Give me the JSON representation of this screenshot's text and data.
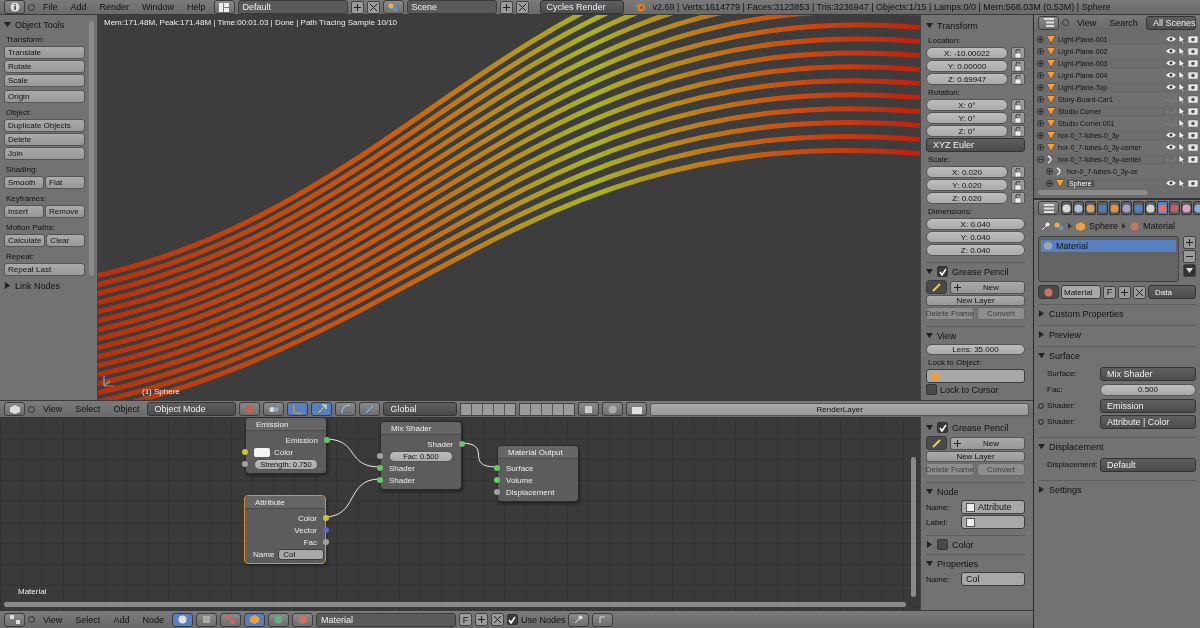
{
  "top_bar": {
    "menus": [
      "File",
      "Add",
      "Render",
      "Window",
      "Help"
    ],
    "layout": "Default",
    "scene": "Scene",
    "engine": "Cycles Render",
    "stats": "v2.69 | Verts:1614779 | Faces:3123853 | Tris:3236947 | Objects:1/15 | Lamps:0/0 | Mem:568.03M (0.53M) | Sphere"
  },
  "tool_shelf": {
    "title": "Object Tools",
    "expanded": true,
    "groups": [
      {
        "label": "Transform:",
        "rows": [
          [
            "Translate"
          ],
          [
            "Rotate"
          ],
          [
            "Scale"
          ]
        ]
      },
      {
        "rows": [
          [
            "Origin"
          ]
        ]
      },
      {
        "label": "Object:",
        "rows": [
          [
            "Duplicate Objects"
          ],
          [
            "Delete"
          ],
          [
            "Join"
          ]
        ]
      },
      {
        "label": "Shading:",
        "rows": [
          [
            "Smooth",
            "Flat"
          ]
        ]
      },
      {
        "label": "Keyframes:",
        "rows": [
          [
            "Insert",
            "Remove"
          ]
        ]
      },
      {
        "label": "Motion Paths:",
        "rows": [
          [
            "Calculate",
            "Clear"
          ]
        ]
      },
      {
        "label": "Repeat:",
        "rows": [
          [
            "Repeat Last"
          ]
        ]
      }
    ],
    "closed_panel": {
      "title": "Link Nodes",
      "expanded": false
    }
  },
  "viewport": {
    "info": "Mem:171.48M, Peak:171.48M | Time:00:01.03 | Done | Path Tracing Sample 10/10",
    "object_label": "(1) Sphere"
  },
  "view_sidebar": {
    "panels": [
      {
        "kind": "transform",
        "title": "Transform",
        "expanded": true,
        "groups": [
          {
            "kind": "vector",
            "label": "Location:",
            "fields": [
              "X: -10.00022",
              "Y: 0.00000",
              "Z: 0.69947"
            ],
            "locks": true
          },
          {
            "kind": "vector",
            "label": "Rotation:",
            "fields": [
              "X: 0°",
              "Y: 0°",
              "Z: 0°"
            ],
            "locks": true
          },
          {
            "kind": "dropdown",
            "value": "XYZ Euler"
          },
          {
            "kind": "vector",
            "label": "Scale:",
            "fields": [
              "X: 0.020",
              "Y: 0.020",
              "Z: 0.020"
            ],
            "locks": true
          },
          {
            "kind": "vector",
            "label": "Dimensions:",
            "fields": [
              "X: 0.040",
              "Y: 0.040",
              "Z: 0.040"
            ],
            "locks": false
          }
        ]
      },
      {
        "kind": "grease_pencil",
        "title": "Grease Pencil",
        "expanded": true,
        "checked": true,
        "new_label": "New",
        "buttons": [
          {
            "label": "New Layer",
            "disabled": false
          }
        ],
        "pair": [
          {
            "label": "Delete Frame",
            "disabled": true
          },
          {
            "label": "Convert",
            "disabled": true
          }
        ]
      },
      {
        "kind": "view",
        "title": "View",
        "expanded": true,
        "lens": "Lens: 35.000",
        "lock_label": "Lock to Object:",
        "cursor": {
          "label": "Lock to Cursor",
          "checked": false
        }
      }
    ]
  },
  "viewport_header": {
    "menus": [
      "View",
      "Select",
      "Object"
    ],
    "mode": "Object Mode",
    "orientation": "Global",
    "render_layer": "RenderLayer"
  },
  "node_editor": {
    "nodes": [
      {
        "title": "Emission",
        "selected": false,
        "rows": [
          {
            "kind": "output",
            "label": "Emission",
            "color": "#63c763"
          },
          {
            "kind": "swatch",
            "label": "Color",
            "color": "#c7c729",
            "swatch": {
              "color": "#f4f4f4"
            }
          },
          {
            "kind": "field",
            "label": "Strength: 0.750",
            "color": "#a1a1a1"
          }
        ]
      },
      {
        "title": "Mix Shader",
        "selected": false,
        "rows": [
          {
            "kind": "output",
            "label": "Shader",
            "color": "#63c763"
          },
          {
            "kind": "field",
            "label": "Fac: 0.500",
            "color": "#a1a1a1"
          },
          {
            "kind": "input",
            "label": "Shader",
            "color": "#63c763"
          },
          {
            "kind": "input",
            "label": "Shader",
            "color": "#63c763"
          }
        ]
      },
      {
        "title": "Material Output",
        "selected": false,
        "rows": [
          {
            "kind": "input",
            "label": "Surface",
            "color": "#63c763"
          },
          {
            "kind": "input",
            "label": "Volume",
            "color": "#63c763"
          },
          {
            "kind": "input",
            "label": "Displacement",
            "color": "#a1a1a1"
          }
        ]
      },
      {
        "title": "Attribute",
        "selected": true,
        "rows": [
          {
            "kind": "output",
            "label": "Color",
            "color": "#c7c729"
          },
          {
            "kind": "output",
            "label": "Vector",
            "color": "#6363c7"
          },
          {
            "kind": "output",
            "label": "Fac",
            "color": "#a1a1a1"
          },
          {
            "kind": "name_field",
            "label": "Name",
            "value": "Col"
          }
        ]
      }
    ],
    "tree_label": "Material"
  },
  "node_sidebar": {
    "panels": [
      {
        "kind": "grease_pencil",
        "title": "Grease Pencil",
        "expanded": true,
        "checked": true,
        "new_label": "New",
        "buttons": [
          {
            "label": "New Layer",
            "disabled": false
          }
        ],
        "pair": [
          {
            "label": "Delete Frame",
            "disabled": true
          },
          {
            "label": "Convert",
            "disabled": true
          }
        ]
      },
      {
        "kind": "fields",
        "title": "Node",
        "expanded": true,
        "fields": [
          {
            "label": "Name:",
            "value": "Attribute",
            "icon": true
          },
          {
            "label": "Label:",
            "icon": true
          }
        ]
      },
      {
        "kind": "color",
        "title": "Color",
        "expanded": false,
        "checked": false
      },
      {
        "kind": "fields",
        "title": "Properties",
        "expanded": true,
        "fields": [
          {
            "label": "Name:",
            "value": "Col",
            "icon": false
          }
        ]
      }
    ]
  },
  "node_header": {
    "menus": [
      "View",
      "Select",
      "Add",
      "Node"
    ],
    "material": "Material",
    "fake_user": "F",
    "use_nodes": {
      "label": "Use Nodes",
      "checked": true
    }
  },
  "outliner": {
    "menus": [
      "View",
      "Search"
    ],
    "filter": "All Scenes",
    "items": [
      {
        "name": "Light-Plane-001",
        "kind": "mesh",
        "restrict": true,
        "visible": true,
        "selected": false,
        "expanded": false
      },
      {
        "name": "Light-Plane-002",
        "kind": "mesh",
        "restrict": true,
        "visible": true,
        "selected": false,
        "expanded": false
      },
      {
        "name": "Light-Plane-003",
        "kind": "mesh",
        "restrict": true,
        "visible": true,
        "selected": false,
        "expanded": false
      },
      {
        "name": "Light-Plane-004",
        "kind": "mesh",
        "restrict": true,
        "visible": true,
        "selected": false,
        "expanded": false
      },
      {
        "name": "Light-Plane-Top",
        "kind": "mesh",
        "restrict": true,
        "visible": true,
        "selected": false,
        "expanded": false
      },
      {
        "name": "Story-Board-Car1",
        "kind": "mesh",
        "restrict": true,
        "visible": false,
        "selected": false,
        "expanded": false
      },
      {
        "name": "Studio Corner",
        "kind": "mesh",
        "restrict": true,
        "visible": false,
        "selected": false,
        "expanded": false
      },
      {
        "name": "Studio Corner.001",
        "kind": "mesh",
        "restrict": true,
        "visible": false,
        "selected": false,
        "expanded": false
      },
      {
        "name": "hor-0_7-tubes-0_3y",
        "kind": "mesh",
        "restrict": true,
        "visible": true,
        "selected": false,
        "expanded": false
      },
      {
        "name": "hor-0_7-tubes-0_3y-center",
        "kind": "mesh",
        "restrict": true,
        "visible": true,
        "selected": false,
        "expanded": false
      },
      {
        "name": "hor-0_7-tubes-0_3y-center",
        "kind": "curve",
        "restrict": true,
        "visible": false,
        "selected": false,
        "expanded": true,
        "children": [
          {
            "name": "hor-0_7-tubes-0_3y-ce",
            "kind": "curve",
            "restrict": false,
            "selected": false,
            "expanded": false
          },
          {
            "name": "Sphere",
            "kind": "mesh",
            "restrict": true,
            "visible": true,
            "selected": true,
            "expanded": false
          }
        ]
      }
    ]
  },
  "properties": {
    "tabs": [
      {
        "selected": false
      },
      {
        "selected": false
      },
      {
        "selected": false
      },
      {
        "selected": false
      },
      {
        "selected": false
      },
      {
        "selected": false
      },
      {
        "selected": false
      },
      {
        "selected": false
      },
      {
        "selected": true
      },
      {
        "selected": false
      },
      {
        "selected": false
      },
      {
        "selected": false
      }
    ],
    "breadcrumb": [
      "Sphere",
      "Material"
    ],
    "slots": [
      {
        "name": "Material",
        "selected": true
      }
    ],
    "material": "Material",
    "fake_user": "F",
    "link": "Data",
    "panels": [
      {
        "title": "Custom Properties",
        "expanded": false
      },
      {
        "title": "Preview",
        "expanded": false
      },
      {
        "title": "Surface",
        "expanded": true,
        "rows": [
          {
            "kind": "dropdown",
            "label": "Surface:",
            "value": "Mix Shader",
            "socket": false
          },
          {
            "kind": "number",
            "label": "Fac:",
            "value": "0.500",
            "socket": false
          },
          {
            "kind": "dropdown",
            "label": "Shader:",
            "value": "Emission",
            "socket": true
          },
          {
            "kind": "dropdown",
            "label": "Shader:",
            "value": "Attribute | Color",
            "socket": true
          }
        ]
      },
      {
        "title": "Displacement",
        "expanded": true,
        "rows": [
          {
            "kind": "dropdown",
            "label": "Displacement:",
            "value": "Default",
            "socket": false
          }
        ]
      },
      {
        "title": "Settings",
        "expanded": false
      }
    ]
  }
}
